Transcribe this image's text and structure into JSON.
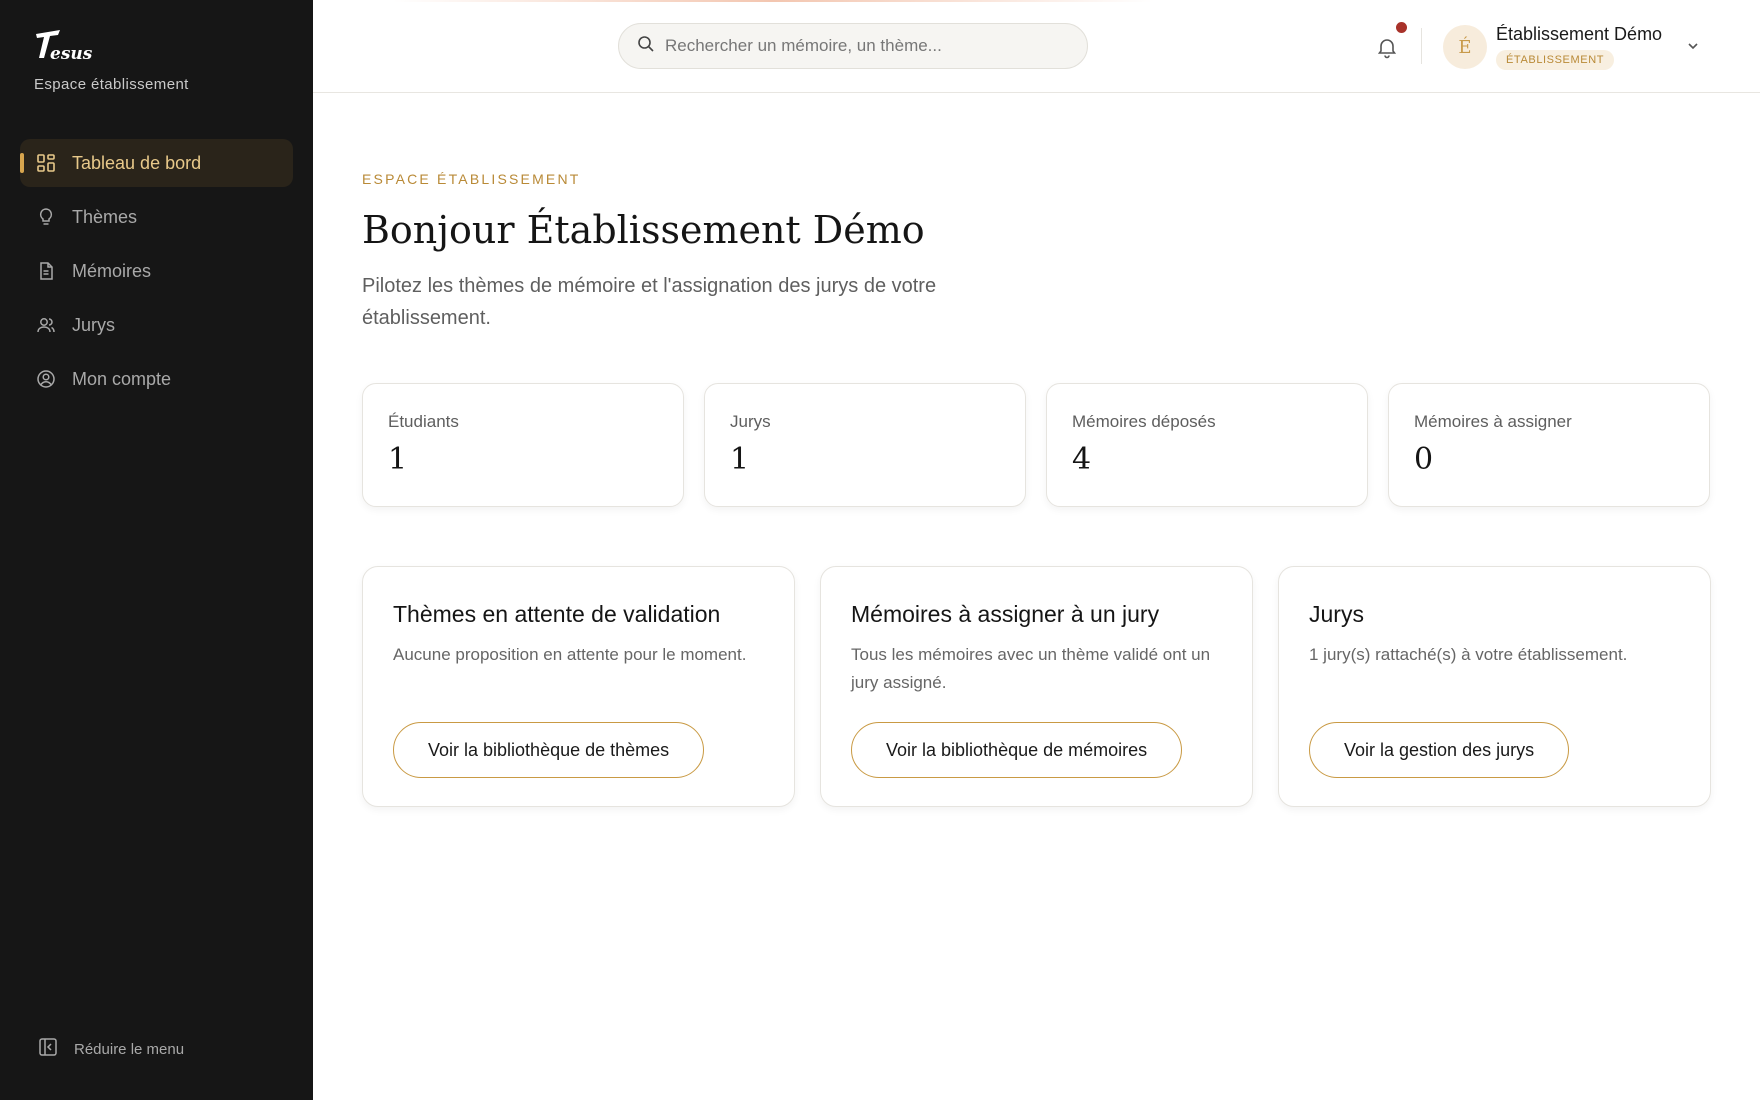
{
  "sidebar": {
    "logo_text": "Thesus",
    "subtitle": "Espace établissement",
    "items": [
      {
        "label": "Tableau de bord",
        "icon": "dashboard-icon",
        "active": true
      },
      {
        "label": "Thèmes",
        "icon": "lightbulb-icon",
        "active": false
      },
      {
        "label": "Mémoires",
        "icon": "document-icon",
        "active": false
      },
      {
        "label": "Jurys",
        "icon": "users-icon",
        "active": false
      },
      {
        "label": "Mon compte",
        "icon": "user-circle-icon",
        "active": false
      }
    ],
    "collapse_label": "Réduire le menu"
  },
  "header": {
    "search_placeholder": "Rechercher un mémoire, un thème...",
    "user": {
      "initial": "É",
      "name": "Établissement Démo",
      "role": "ÉTABLISSEMENT"
    },
    "has_notification": true
  },
  "main": {
    "eyebrow": "ESPACE ÉTABLISSEMENT",
    "title": "Bonjour Établissement Démo",
    "subtitle": "Pilotez les thèmes de mémoire et l'assignation des jurys de votre établissement.",
    "stats": [
      {
        "label": "Étudiants",
        "value": "1"
      },
      {
        "label": "Jurys",
        "value": "1"
      },
      {
        "label": "Mémoires déposés",
        "value": "4"
      },
      {
        "label": "Mémoires à assigner",
        "value": "0"
      }
    ],
    "cards": [
      {
        "title": "Thèmes en attente de validation",
        "description": "Aucune proposition en attente pour le moment.",
        "button": "Voir la bibliothèque de thèmes"
      },
      {
        "title": "Mémoires à assigner à un jury",
        "description": "Tous les mémoires avec un thème validé ont un jury assigné.",
        "button": "Voir la bibliothèque de mémoires"
      },
      {
        "title": "Jurys",
        "description": "1 jury(s) rattaché(s) à votre établissement.",
        "button": "Voir la gestion des jurys"
      }
    ]
  },
  "colors": {
    "sidebar_bg": "#161616",
    "accent_gold": "#c99a44",
    "active_text": "#e8c98a",
    "notification_dot": "#a8322a"
  }
}
